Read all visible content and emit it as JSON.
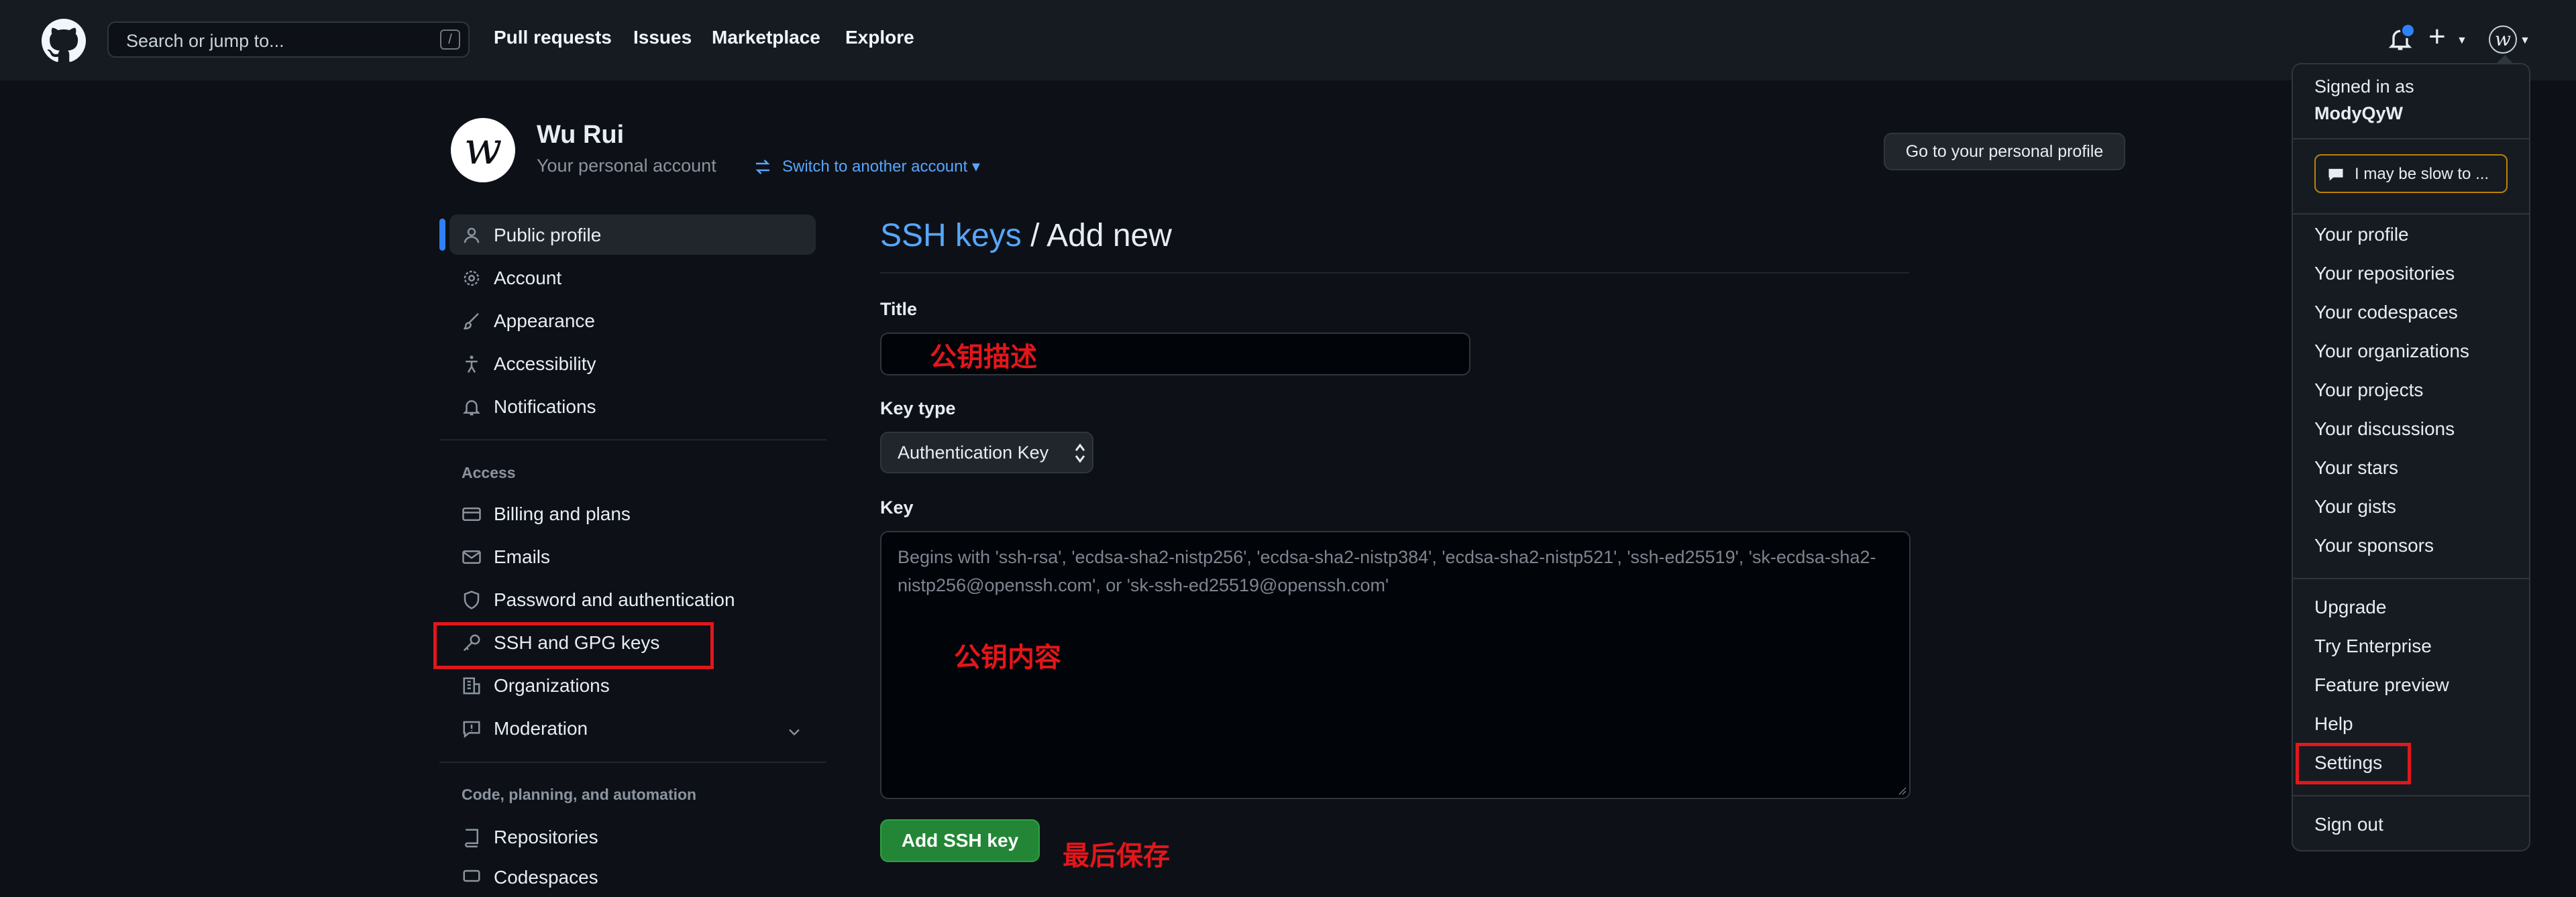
{
  "header": {
    "search_placeholder": "Search or jump to...",
    "search_shortcut": "/",
    "nav": [
      "Pull requests",
      "Issues",
      "Marketplace",
      "Explore"
    ],
    "plus_symbol": "+",
    "avatar_letter": "w"
  },
  "account": {
    "avatar_letter": "w",
    "name": "Wu Rui",
    "subtitle": "Your personal account",
    "switch_label": "Switch to another account ▾",
    "profile_button": "Go to your personal profile"
  },
  "sidebar": {
    "items_top": [
      {
        "label": "Public profile",
        "icon": "person-icon",
        "active": true
      },
      {
        "label": "Account",
        "icon": "gear-icon"
      },
      {
        "label": "Appearance",
        "icon": "paintbrush-icon"
      },
      {
        "label": "Accessibility",
        "icon": "accessibility-icon"
      },
      {
        "label": "Notifications",
        "icon": "bell-icon"
      }
    ],
    "section_access": "Access",
    "items_access": [
      {
        "label": "Billing and plans",
        "icon": "credit-card-icon"
      },
      {
        "label": "Emails",
        "icon": "mail-icon"
      },
      {
        "label": "Password and authentication",
        "icon": "shield-icon"
      },
      {
        "label": "SSH and GPG keys",
        "icon": "key-icon",
        "highlighted": true
      },
      {
        "label": "Organizations",
        "icon": "organization-icon"
      },
      {
        "label": "Moderation",
        "icon": "report-icon",
        "expandable": true
      }
    ],
    "section_code": "Code, planning, and automation",
    "items_code": [
      {
        "label": "Repositories",
        "icon": "repo-icon"
      },
      {
        "label": "Codespaces",
        "icon": "codespaces-icon"
      }
    ]
  },
  "main": {
    "title_link": "SSH keys",
    "title_rest": " / Add new",
    "title_label": "Title",
    "title_annotation": "公钥描述",
    "keytype_label": "Key type",
    "keytype_value": "Authentication Key",
    "key_label": "Key",
    "key_placeholder": "Begins with 'ssh-rsa', 'ecdsa-sha2-nistp256', 'ecdsa-sha2-nistp384', 'ecdsa-sha2-nistp521', 'ssh-ed25519', 'sk-ecdsa-sha2-nistp256@openssh.com', or 'sk-ssh-ed25519@openssh.com'",
    "key_annotation": "公钥内容",
    "submit_label": "Add SSH key",
    "submit_annotation": "最后保存"
  },
  "dropdown": {
    "signed_in_as": "Signed in as",
    "username": "ModyQyW",
    "status": "I may be slow to ...",
    "group1": [
      "Your profile",
      "Your repositories",
      "Your codespaces",
      "Your organizations",
      "Your projects",
      "Your discussions",
      "Your stars",
      "Your gists",
      "Your sponsors"
    ],
    "group2": [
      "Upgrade",
      "Try Enterprise",
      "Feature preview",
      "Help",
      "Settings"
    ],
    "sign_out": "Sign out"
  },
  "colors": {
    "background": "#0d1117",
    "header": "#161b22",
    "accent_blue": "#58a6ff",
    "button_green": "#238636",
    "annotation_red": "#e3161a"
  }
}
